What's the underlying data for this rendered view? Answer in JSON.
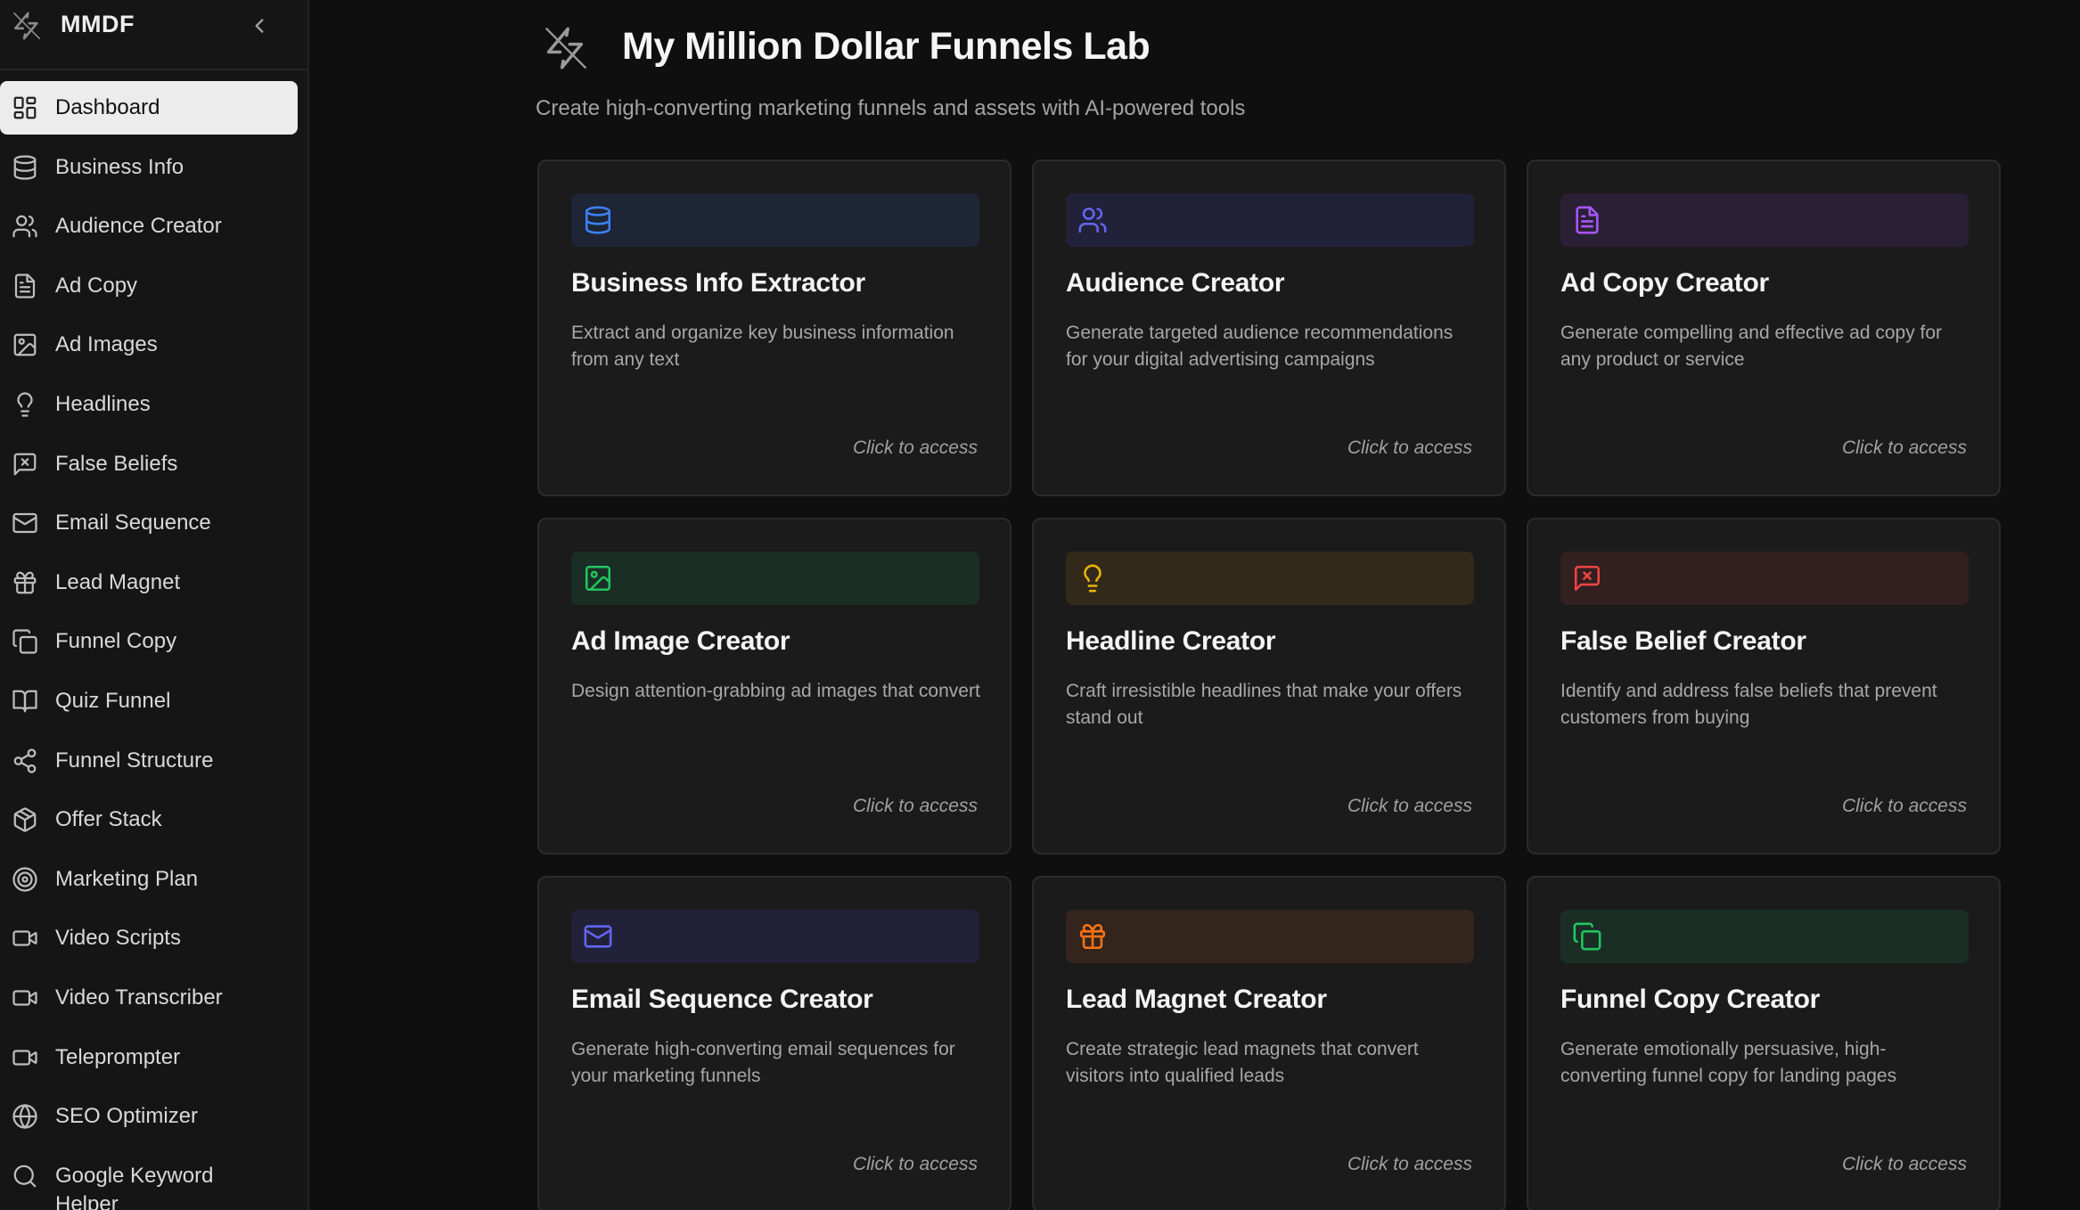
{
  "app": {
    "brand": "MMDF"
  },
  "sidebar": {
    "items": [
      {
        "label": "Dashboard",
        "icon": "dashboard-icon"
      },
      {
        "label": "Business Info",
        "icon": "database-icon"
      },
      {
        "label": "Audience Creator",
        "icon": "users-icon"
      },
      {
        "label": "Ad Copy",
        "icon": "document-icon"
      },
      {
        "label": "Ad Images",
        "icon": "image-icon"
      },
      {
        "label": "Headlines",
        "icon": "lightbulb-icon"
      },
      {
        "label": "False Beliefs",
        "icon": "message-x-icon"
      },
      {
        "label": "Email Sequence",
        "icon": "mail-icon"
      },
      {
        "label": "Lead Magnet",
        "icon": "gift-icon"
      },
      {
        "label": "Funnel Copy",
        "icon": "copy-icon"
      },
      {
        "label": "Quiz Funnel",
        "icon": "book-icon"
      },
      {
        "label": "Funnel Structure",
        "icon": "share-icon"
      },
      {
        "label": "Offer Stack",
        "icon": "package-icon"
      },
      {
        "label": "Marketing Plan",
        "icon": "target-icon"
      },
      {
        "label": "Video Scripts",
        "icon": "video-icon"
      },
      {
        "label": "Video Transcriber",
        "icon": "video-icon"
      },
      {
        "label": "Teleprompter",
        "icon": "video-icon"
      },
      {
        "label": "SEO Optimizer",
        "icon": "globe-icon"
      },
      {
        "label": "Google Keyword Helper",
        "icon": "search-icon"
      }
    ]
  },
  "header": {
    "title": "My Million Dollar Funnels Lab",
    "subtitle": "Create high-converting marketing funnels and assets with AI-powered tools"
  },
  "cards": [
    {
      "title": "Business Info Extractor",
      "description": "Extract and organize key business information from any text",
      "access": "Click to access",
      "icon": "database-icon",
      "accent": "#3b82f6",
      "banner": "#1e2536"
    },
    {
      "title": "Audience Creator",
      "description": "Generate targeted audience recommendations for your digital advertising campaigns",
      "access": "Click to access",
      "icon": "users-icon",
      "accent": "#6366f1",
      "banner": "#22213a"
    },
    {
      "title": "Ad Copy Creator",
      "description": "Generate compelling and effective ad copy for any product or service",
      "access": "Click to access",
      "icon": "document-icon",
      "accent": "#a855f7",
      "banner": "#2a2036"
    },
    {
      "title": "Ad Image Creator",
      "description": "Design attention-grabbing ad images that convert",
      "access": "Click to access",
      "icon": "image-icon",
      "accent": "#22c55e",
      "banner": "#1a2e26"
    },
    {
      "title": "Headline Creator",
      "description": "Craft irresistible headlines that make your offers stand out",
      "access": "Click to access",
      "icon": "lightbulb-icon",
      "accent": "#eab308",
      "banner": "#33291a"
    },
    {
      "title": "False Belief Creator",
      "description": "Identify and address false beliefs that prevent customers from buying",
      "access": "Click to access",
      "icon": "message-x-icon",
      "accent": "#ef4444",
      "banner": "#321f1f"
    },
    {
      "title": "Email Sequence Creator",
      "description": "Generate high-converting email sequences for your marketing funnels",
      "access": "Click to access",
      "icon": "mail-icon",
      "accent": "#6366f1",
      "banner": "#22213a"
    },
    {
      "title": "Lead Magnet Creator",
      "description": "Create strategic lead magnets that convert visitors into qualified leads",
      "access": "Click to access",
      "icon": "gift-icon",
      "accent": "#f97316",
      "banner": "#33251c"
    },
    {
      "title": "Funnel Copy Creator",
      "description": "Generate emotionally persuasive, high-converting funnel copy for landing pages",
      "access": "Click to access",
      "icon": "copy-icon",
      "accent": "#22c55e",
      "banner": "#1a2e26"
    }
  ]
}
